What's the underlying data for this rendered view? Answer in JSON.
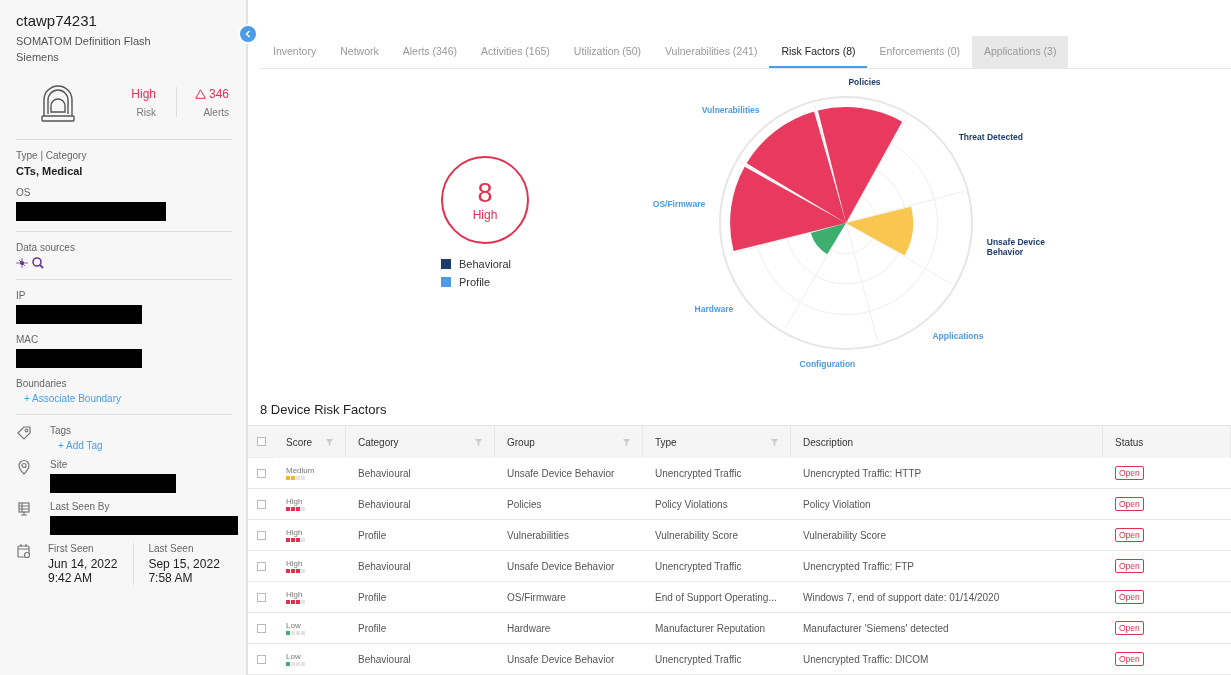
{
  "device": {
    "name": "ctawp74231",
    "model": "SOMATOM Definition Flash",
    "vendor": "Siemens",
    "risk": {
      "value": "High",
      "label": "Risk"
    },
    "alerts": {
      "value": "346",
      "label": "Alerts"
    }
  },
  "details": [
    {
      "kind": "text",
      "label": "Type | Category",
      "value": "CTs, Medical"
    },
    {
      "kind": "redacted",
      "label": "OS"
    },
    {
      "kind": "sources",
      "label": "Data sources"
    },
    {
      "kind": "redacted",
      "label": "IP"
    },
    {
      "kind": "redacted",
      "label": "MAC"
    },
    {
      "kind": "link",
      "label": "Boundaries",
      "value": "+ Associate Boundary"
    }
  ],
  "extras": [
    {
      "kind": "link",
      "label": "Tags",
      "value": "+ Add Tag"
    },
    {
      "kind": "redacted",
      "label": "Site"
    },
    {
      "kind": "redacted",
      "label": "Last Seen By"
    }
  ],
  "seen": [
    {
      "label": "First Seen",
      "date": "Jun 14, 2022",
      "time": "9:42 AM"
    },
    {
      "label": "Last Seen",
      "date": "Sep 15, 2022",
      "time": "7:58 AM"
    }
  ],
  "tabs": [
    {
      "label": "Inventory",
      "selected": false,
      "disabled": false
    },
    {
      "label": "Network",
      "selected": false,
      "disabled": false
    },
    {
      "label": "Alerts (346)",
      "selected": false,
      "disabled": false
    },
    {
      "label": "Activities (165)",
      "selected": false,
      "disabled": false
    },
    {
      "label": "Utilization (50)",
      "selected": false,
      "disabled": false
    },
    {
      "label": "Vulnerabilities (241)",
      "selected": false,
      "disabled": false
    },
    {
      "label": "Risk Factors (8)",
      "selected": true,
      "disabled": false
    },
    {
      "label": "Enforcements (0)",
      "selected": false,
      "disabled": false
    },
    {
      "label": "Applications (3)",
      "selected": false,
      "disabled": true
    }
  ],
  "score": {
    "value": "8",
    "label": "High"
  },
  "legend": [
    {
      "label": "Behavioral",
      "color": "#1d3b6b"
    },
    {
      "label": "Profile",
      "color": "#4a9be8"
    }
  ],
  "radar": [
    {
      "label": "Policies",
      "kind": "behavioral",
      "color": "#e8395f"
    },
    {
      "label": "Threat Detected",
      "kind": "behavioral"
    },
    {
      "label": "Unsafe Device Behavior",
      "kind": "behavioral",
      "color": "#f9c650"
    },
    {
      "label": "Applications",
      "kind": "profile"
    },
    {
      "label": "Configuration",
      "kind": "profile"
    },
    {
      "label": "Hardware",
      "kind": "profile",
      "color": "#3dae6e"
    },
    {
      "label": "OS/Firmware",
      "kind": "profile",
      "color": "#e8395f"
    },
    {
      "label": "Vulnerabilities",
      "kind": "profile",
      "color": "#e8395f"
    }
  ],
  "table": {
    "title": "8 Device Risk Factors",
    "select_all_checked": false,
    "columns": [
      {
        "label": "Score",
        "filter": true
      },
      {
        "label": "Category",
        "filter": true
      },
      {
        "label": "Group",
        "filter": true
      },
      {
        "label": "Type",
        "filter": true
      },
      {
        "label": "Description",
        "filter": false
      },
      {
        "label": "Status",
        "filter": false
      }
    ],
    "rows": [
      {
        "checked": false,
        "score": "Medium",
        "kind": "medium",
        "category": "Behavioural",
        "group": "Unsafe Device Behavior",
        "type": "Unencrypted Traffic",
        "description": "Unencrypted Traffic: HTTP",
        "status": "Open"
      },
      {
        "checked": false,
        "score": "High",
        "kind": "high",
        "category": "Behavioural",
        "group": "Policies",
        "type": "Policy Violations",
        "description": "Policy Violation",
        "status": "Open"
      },
      {
        "checked": false,
        "score": "High",
        "kind": "high",
        "category": "Profile",
        "group": "Vulnerabilities",
        "type": "Vulnerability Score",
        "description": "Vulnerability Score",
        "status": "Open"
      },
      {
        "checked": false,
        "score": "High",
        "kind": "high",
        "category": "Behavioural",
        "group": "Unsafe Device Behavior",
        "type": "Unencrypted Traffic",
        "description": "Unencrypted Traffic: FTP",
        "status": "Open"
      },
      {
        "checked": false,
        "score": "High",
        "kind": "high",
        "category": "Profile",
        "group": "OS/Firmware",
        "type": "End of Support Operating...",
        "description": "Windows 7, end of support date: 01/14/2020",
        "status": "Open"
      },
      {
        "checked": false,
        "score": "Low",
        "kind": "low",
        "category": "Profile",
        "group": "Hardware",
        "type": "Manufacturer Reputation",
        "description": "Manufacturer 'Siemens' detected",
        "status": "Open"
      },
      {
        "checked": false,
        "score": "Low",
        "kind": "low",
        "category": "Behavioural",
        "group": "Unsafe Device Behavior",
        "type": "Unencrypted Traffic",
        "description": "Unencrypted Traffic: DICOM",
        "status": "Open"
      }
    ]
  }
}
